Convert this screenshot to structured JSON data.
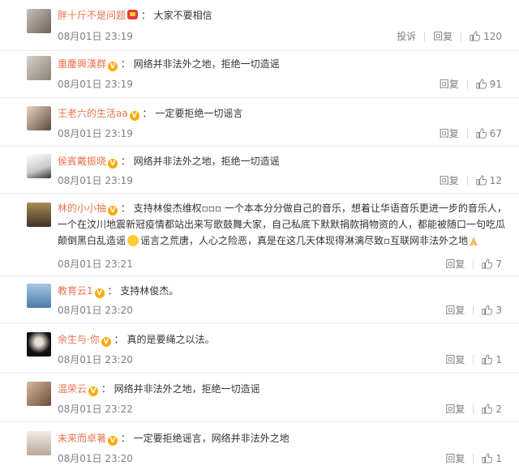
{
  "comments": [
    {
      "user": "胖十斤不是问题",
      "badge": "crown",
      "text": "大家不要相信",
      "time": "08月01日 23:19",
      "report": "投诉",
      "reply": "回复",
      "likes": "120"
    },
    {
      "user": "重鏖興漢群",
      "badge": "v",
      "text": "网络并非法外之地，拒绝一切造谣",
      "time": "08月01日 23:19",
      "reply": "回复",
      "likes": "91"
    },
    {
      "user": "王老六的生活aa",
      "badge": "v",
      "text": "一定要拒绝一切谣言",
      "time": "08月01日 23:19",
      "reply": "回复",
      "likes": "67"
    },
    {
      "user": "侯賓戴振晓",
      "badge": "v",
      "text": "网络并非法外之地，拒绝一切造谣",
      "time": "08月01日 23:19",
      "reply": "回复",
      "likes": "12"
    },
    {
      "user": "林的小小抽",
      "badge": "v",
      "text": "支持林俊杰维权▫▫▫ 一个本本分分做自己的音乐，想着让华语音乐更进一步的音乐人，一个在汶川地震新冠疫情都站出来写歌鼓舞大家，自己私底下默默捐款捐物资的人，都能被随口一句吃瓜颠倒黑白乱造谣",
      "text2": "谣言之荒唐，人心之险恶，真是在这几天体现得淋漓尽致▫互联网非法外之地",
      "time": "08月01日 23:21",
      "reply": "回复",
      "likes": "7"
    },
    {
      "user": "教育云1",
      "badge": "v",
      "text": "支持林俊杰。",
      "time": "08月01日 23:20",
      "reply": "回复",
      "likes": "3"
    },
    {
      "user": "余生与·你",
      "badge": "v",
      "text": "真的是要绳之以法。",
      "time": "08月01日 23:20",
      "reply": "回复",
      "likes": "1"
    },
    {
      "user": "温荣云",
      "badge": "v",
      "text": "网络并非法外之地，拒绝一切造谣",
      "time": "08月01日 23:22",
      "reply": "回复",
      "likes": "2"
    },
    {
      "user": "未来而卓著",
      "badge": "v",
      "text": "一定要拒绝谣言，网络并非法外之地",
      "time": "08月01日 23:20",
      "reply": "回复",
      "likes": "1"
    }
  ],
  "colors": {
    "username": "#eb7350",
    "meta": "#808080",
    "badge": "#ffaa00"
  }
}
